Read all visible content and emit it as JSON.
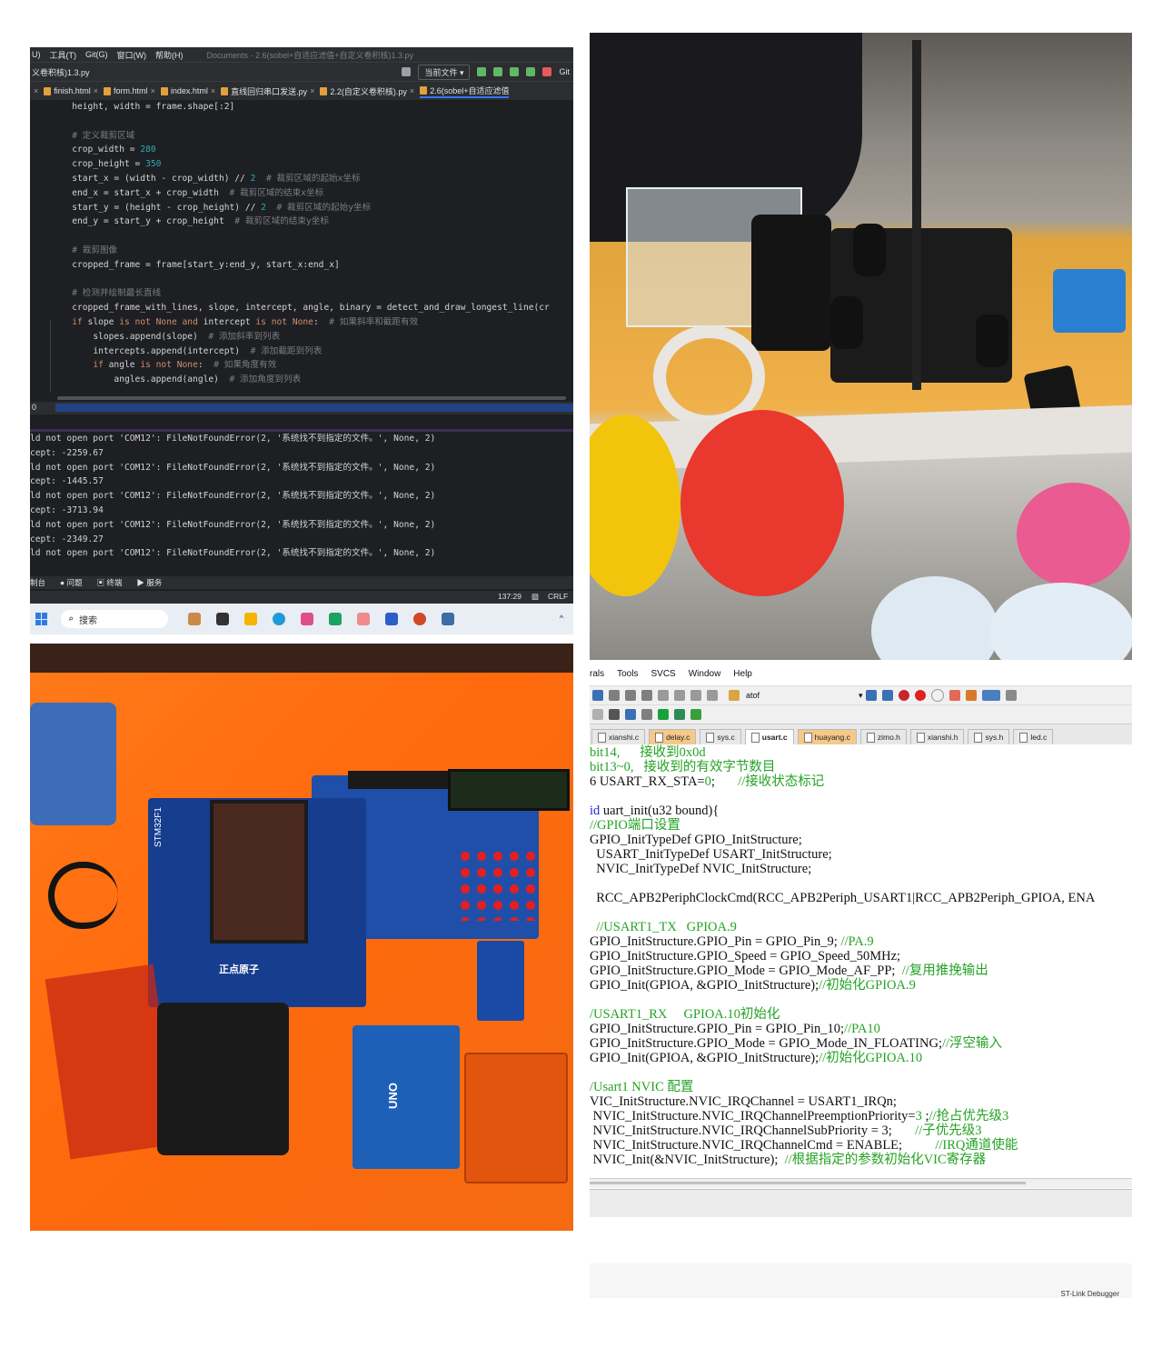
{
  "ide": {
    "menubar": [
      "U)",
      "工具(T)",
      "Git(G)",
      "窗口(W)",
      "帮助(H)"
    ],
    "document_title": "Documents - 2.6(sobel+自适应滤值+自定义卷积核)1.3.py",
    "project_label": "义卷积核)1.3.py",
    "run_config": "当前文件 ▾",
    "git_label": "Git",
    "tabs": [
      {
        "label": "finish.html",
        "close": "×"
      },
      {
        "label": "form.html",
        "close": "×"
      },
      {
        "label": "index.html",
        "close": "×"
      },
      {
        "label": "直线回归串口发送.py",
        "close": "×"
      },
      {
        "label": "2.2(自定义卷积核).py",
        "close": "×"
      },
      {
        "label": "2.6(sobel+自适应滤值",
        "close": ""
      }
    ],
    "code_lines": [
      {
        "indent": "        ",
        "parts": [
          {
            "t": "height, width = frame.shape[:2]",
            "c": "fn"
          }
        ]
      },
      {
        "indent": "",
        "parts": []
      },
      {
        "indent": "        ",
        "parts": [
          {
            "t": "# 定义裁剪区域",
            "c": "cm"
          }
        ]
      },
      {
        "indent": "        ",
        "parts": [
          {
            "t": "crop_width = ",
            "c": "fn"
          },
          {
            "t": "280",
            "c": "num"
          }
        ]
      },
      {
        "indent": "        ",
        "parts": [
          {
            "t": "crop_height = ",
            "c": "fn"
          },
          {
            "t": "350",
            "c": "num"
          }
        ]
      },
      {
        "indent": "        ",
        "parts": [
          {
            "t": "start_x = (width - crop_width) // ",
            "c": "fn"
          },
          {
            "t": "2",
            "c": "num"
          },
          {
            "t": "  # 裁剪区域的起始x坐标",
            "c": "cm"
          }
        ]
      },
      {
        "indent": "        ",
        "parts": [
          {
            "t": "end_x = start_x + crop_width",
            "c": "fn"
          },
          {
            "t": "  # 裁剪区域的结束x坐标",
            "c": "cm"
          }
        ]
      },
      {
        "indent": "        ",
        "parts": [
          {
            "t": "start_y = (height - crop_height) // ",
            "c": "fn"
          },
          {
            "t": "2",
            "c": "num"
          },
          {
            "t": "  # 裁剪区域的起始y坐标",
            "c": "cm"
          }
        ]
      },
      {
        "indent": "        ",
        "parts": [
          {
            "t": "end_y = start_y + crop_height",
            "c": "fn"
          },
          {
            "t": "  # 裁剪区域的结束y坐标",
            "c": "cm"
          }
        ]
      },
      {
        "indent": "",
        "parts": []
      },
      {
        "indent": "        ",
        "parts": [
          {
            "t": "# 裁剪图像",
            "c": "cm"
          }
        ]
      },
      {
        "indent": "        ",
        "parts": [
          {
            "t": "cropped_frame = frame[start_y:end_y, start_x:end_x]",
            "c": "fn"
          }
        ]
      },
      {
        "indent": "",
        "parts": []
      },
      {
        "indent": "        ",
        "parts": [
          {
            "t": "# 检测并绘制最长直线",
            "c": "cm"
          }
        ]
      },
      {
        "indent": "        ",
        "parts": [
          {
            "t": "cropped_frame_with_lines, slope, intercept, angle, binary = detect_and_draw_longest_line(cr",
            "c": "fn"
          }
        ]
      },
      {
        "indent": "        ",
        "parts": [
          {
            "t": "if",
            "c": "kw"
          },
          {
            "t": " slope ",
            "c": "fn"
          },
          {
            "t": "is not None and",
            "c": "kw"
          },
          {
            "t": " intercept ",
            "c": "fn"
          },
          {
            "t": "is not None",
            "c": "kw"
          },
          {
            "t": ":  ",
            "c": "fn"
          },
          {
            "t": "# 如果斜率和截距有效",
            "c": "cm"
          }
        ]
      },
      {
        "indent": "            ",
        "parts": [
          {
            "t": "slopes.append(slope)",
            "c": "fn"
          },
          {
            "t": "  # 添加斜率到列表",
            "c": "cm"
          }
        ]
      },
      {
        "indent": "            ",
        "parts": [
          {
            "t": "intercepts.append(intercept)",
            "c": "fn"
          },
          {
            "t": "  # 添加截距到列表",
            "c": "cm"
          }
        ]
      },
      {
        "indent": "            ",
        "parts": [
          {
            "t": "if",
            "c": "kw"
          },
          {
            "t": " angle ",
            "c": "fn"
          },
          {
            "t": "is not None",
            "c": "kw"
          },
          {
            "t": ":  ",
            "c": "fn"
          },
          {
            "t": "# 如果角度有效",
            "c": "cm"
          }
        ]
      },
      {
        "indent": "                ",
        "parts": [
          {
            "t": "angles.append(angle)",
            "c": "fn"
          },
          {
            "t": "  # 添加角度到列表",
            "c": "cm"
          }
        ]
      }
    ],
    "status_line_label": "0",
    "console_lines": [
      "ld not open port 'COM12': FileNotFoundError(2, '系统找不到指定的文件。', None, 2)",
      "cept: -2259.67",
      "ld not open port 'COM12': FileNotFoundError(2, '系统找不到指定的文件。', None, 2)",
      "cept: -1445.57",
      "ld not open port 'COM12': FileNotFoundError(2, '系统找不到指定的文件。', None, 2)",
      "cept: -3713.94",
      "ld not open port 'COM12': FileNotFoundError(2, '系统找不到指定的文件。', None, 2)",
      "cept: -2349.27",
      "ld not open port 'COM12': FileNotFoundError(2, '系统找不到指定的文件。', None, 2)"
    ],
    "bottom_tabs": [
      "制台",
      "问题",
      "终端",
      "服务"
    ],
    "cursor_pos": "137:29",
    "line_ending": "CRLF",
    "taskbar_search": "搜索",
    "colors": {
      "bg": "#1e1f22",
      "keyword": "#cf8e6d",
      "number": "#2aacb8",
      "comment": "#7a7e85"
    }
  },
  "keil": {
    "menubar": [
      "rals",
      "Tools",
      "SVCS",
      "Window",
      "Help"
    ],
    "target_combo": "atof",
    "tabs": [
      {
        "label": "xianshi.c",
        "style": "normal"
      },
      {
        "label": "delay.c",
        "style": "orange"
      },
      {
        "label": "sys.c",
        "style": "normal"
      },
      {
        "label": "usart.c",
        "style": "active"
      },
      {
        "label": "huayang.c",
        "style": "orange"
      },
      {
        "label": "zimo.h",
        "style": "normal"
      },
      {
        "label": "xianshi.h",
        "style": "normal"
      },
      {
        "label": "sys.h",
        "style": "normal"
      },
      {
        "label": "led.c",
        "style": "normal"
      }
    ],
    "code_lines": [
      {
        "parts": [
          {
            "t": "bit14,",
            "c": "kg"
          },
          {
            "t": "      接收到0x0d",
            "c": "kg"
          }
        ]
      },
      {
        "parts": [
          {
            "t": "bit13~0,",
            "c": "kg"
          },
          {
            "t": "   接收到的有效字节数目",
            "c": "kg"
          }
        ]
      },
      {
        "parts": [
          {
            "t": "6 USART_RX_STA=",
            "c": ""
          },
          {
            "t": "0",
            "c": "kg"
          },
          {
            "t": ";       ",
            "c": ""
          },
          {
            "t": "//接收状态标记",
            "c": "kg"
          }
        ]
      },
      {
        "parts": []
      },
      {
        "parts": [
          {
            "t": "id",
            "c": "kb"
          },
          {
            "t": " uart_init(u32 bound){",
            "c": ""
          }
        ]
      },
      {
        "parts": [
          {
            "t": "//GPIO端口设置",
            "c": "kg"
          }
        ]
      },
      {
        "parts": [
          {
            "t": "GPIO_InitTypeDef GPIO_InitStructure;",
            "c": ""
          }
        ]
      },
      {
        "parts": [
          {
            "t": "  USART_InitTypeDef USART_InitStructure;",
            "c": ""
          }
        ]
      },
      {
        "parts": [
          {
            "t": "  NVIC_InitTypeDef NVIC_InitStructure;",
            "c": ""
          }
        ]
      },
      {
        "parts": []
      },
      {
        "parts": [
          {
            "t": "  RCC_APB2PeriphClockCmd(RCC_APB2Periph_USART1|RCC_APB2Periph_GPIOA, ENA",
            "c": ""
          }
        ]
      },
      {
        "parts": []
      },
      {
        "parts": [
          {
            "t": "  //USART1_TX   GPIOA.9",
            "c": "kg"
          }
        ]
      },
      {
        "parts": [
          {
            "t": "GPIO_InitStructure.GPIO_Pin = GPIO_Pin_9; ",
            "c": ""
          },
          {
            "t": "//PA.9",
            "c": "kg"
          }
        ]
      },
      {
        "parts": [
          {
            "t": "GPIO_InitStructure.GPIO_Speed = GPIO_Speed_50MHz;",
            "c": ""
          }
        ]
      },
      {
        "parts": [
          {
            "t": "GPIO_InitStructure.GPIO_Mode = GPIO_Mode_AF_PP;  ",
            "c": ""
          },
          {
            "t": "//复用推挽输出",
            "c": "kg"
          }
        ]
      },
      {
        "parts": [
          {
            "t": "GPIO_Init(GPIOA, &GPIO_InitStructure);",
            "c": ""
          },
          {
            "t": "//初始化GPIOA.9",
            "c": "kg"
          }
        ]
      },
      {
        "parts": []
      },
      {
        "parts": [
          {
            "t": "/USART1_RX     GPIOA.10初始化",
            "c": "kg"
          }
        ]
      },
      {
        "parts": [
          {
            "t": "GPIO_InitStructure.GPIO_Pin = GPIO_Pin_10;",
            "c": ""
          },
          {
            "t": "//PA10",
            "c": "kg"
          }
        ]
      },
      {
        "parts": [
          {
            "t": "GPIO_InitStructure.GPIO_Mode = GPIO_Mode_IN_FLOATING;",
            "c": ""
          },
          {
            "t": "//浮空输入",
            "c": "kg"
          }
        ]
      },
      {
        "parts": [
          {
            "t": "GPIO_Init(GPIOA, &GPIO_InitStructure);",
            "c": ""
          },
          {
            "t": "//初始化GPIOA.10",
            "c": "kg"
          }
        ]
      },
      {
        "parts": []
      },
      {
        "parts": [
          {
            "t": "/Usart1 NVIC 配置",
            "c": "kg"
          }
        ]
      },
      {
        "parts": [
          {
            "t": "VIC_InitStructure.NVIC_IRQChannel = USART1_IRQn;",
            "c": ""
          }
        ]
      },
      {
        "parts": [
          {
            "t": " NVIC_InitStructure.NVIC_IRQChannelPreemptionPriority=",
            "c": ""
          },
          {
            "t": "3",
            "c": "kg"
          },
          {
            "t": " ;",
            "c": ""
          },
          {
            "t": "//抢占优先级3",
            "c": "kg"
          }
        ]
      },
      {
        "parts": [
          {
            "t": " NVIC_InitStructure.NVIC_IRQChannelSubPriority = 3;       ",
            "c": ""
          },
          {
            "t": "//子优先级3",
            "c": "kg"
          }
        ]
      },
      {
        "parts": [
          {
            "t": " NVIC_InitStructure.NVIC_IRQChannelCmd = ENABLE;          ",
            "c": ""
          },
          {
            "t": "//IRQ通道使能",
            "c": "kg"
          }
        ]
      },
      {
        "parts": [
          {
            "t": " NVIC_Init(&NVIC_InitStructure);  ",
            "c": ""
          },
          {
            "t": "//根据指定的参数初始化VIC寄存器",
            "c": "kg"
          }
        ]
      }
    ],
    "debugger_label": "ST-Link Debugger"
  },
  "photos": {
    "board_label_1": "STM32F1",
    "board_label_2": "正点原子",
    "board_label_3": "UNO"
  }
}
